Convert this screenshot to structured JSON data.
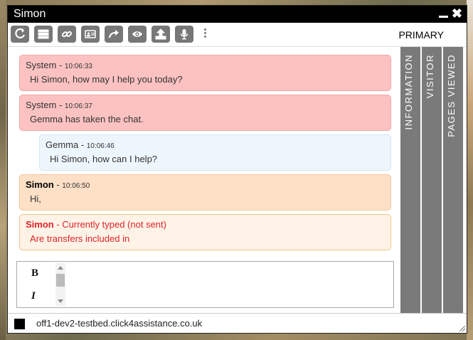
{
  "window": {
    "title": "Simon"
  },
  "toolbar": {
    "buttons": [
      "refresh-icon",
      "list-icon",
      "link-icon",
      "contact-card-icon",
      "forward-icon",
      "eye-icon",
      "upload-icon",
      "microphone-icon"
    ],
    "queue_label": "PRIMARY"
  },
  "messages": [
    {
      "sender": "System",
      "time": "10:06:33",
      "text": "Hi Simon, how may I help you today?",
      "type": "system"
    },
    {
      "sender": "System",
      "time": "10:06:37",
      "text": "Gemma has taken the chat.",
      "type": "system"
    },
    {
      "sender": "Gemma",
      "time": "10:06:46",
      "text": "Hi Simon, how can I help?",
      "type": "agent"
    },
    {
      "sender": "Simon",
      "time": "10:06:50",
      "text": "Hi,",
      "type": "visitor"
    }
  ],
  "typing": {
    "sender": "Simon",
    "status": "Currently typed (not sent)",
    "text": "Are transfers included in"
  },
  "editor": {
    "bold": "B",
    "italic": "I"
  },
  "side_tabs": [
    "INFORMATION",
    "VISITOR",
    "PAGES VIEWED"
  ],
  "status": {
    "host": "off1-dev2-testbed.click4assistance.co.uk"
  },
  "colors": {
    "system": "#fcc2c2",
    "agent": "#eef6fd",
    "visitor": "#fde0c6",
    "typing_text": "#e0222b",
    "tab": "#7a7a7a"
  }
}
